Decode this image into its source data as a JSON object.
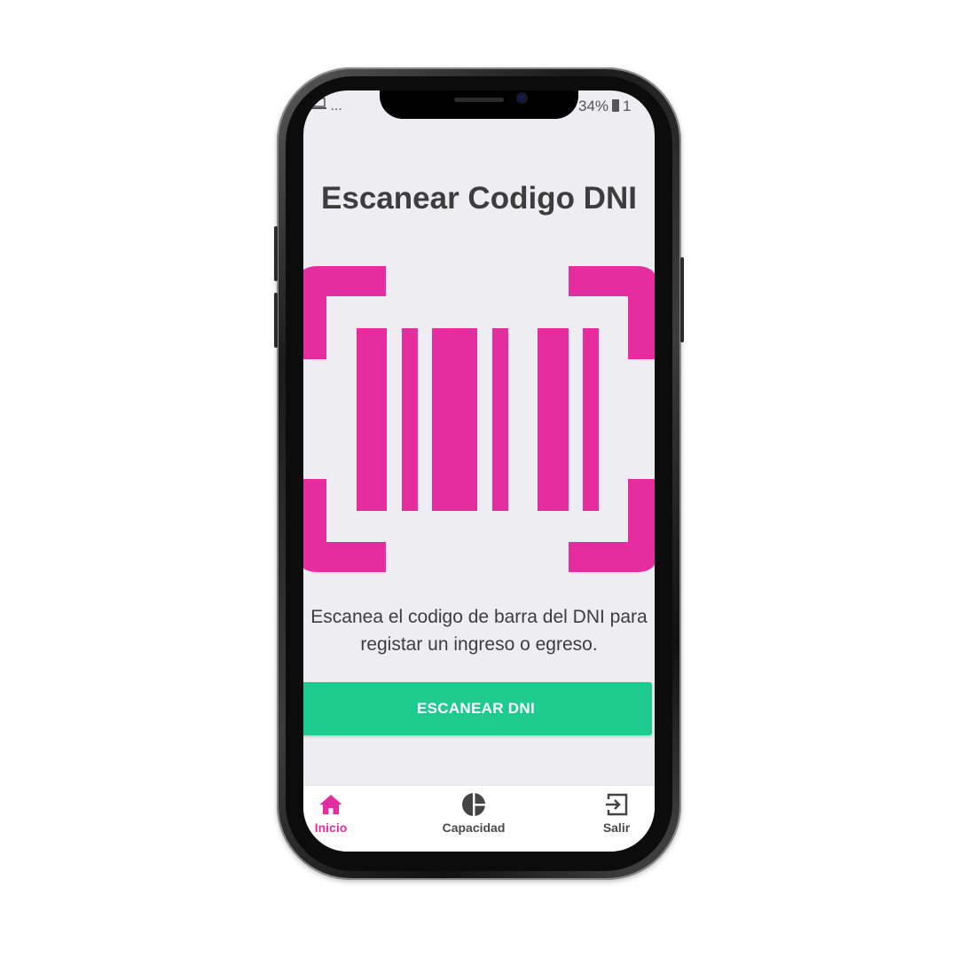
{
  "status_bar": {
    "left_text": "...",
    "battery": "34%",
    "time": "1"
  },
  "page": {
    "title": "Escanear Codigo DNI",
    "description_line1": "Escanea el codigo de barra del DNI para",
    "description_line2": "registar un ingreso o egreso.",
    "scan_button_label": "ESCANEAR DNI"
  },
  "tabs": [
    {
      "label": "Inicio",
      "icon": "home-icon",
      "active": true
    },
    {
      "label": "Capacidad",
      "icon": "pie-chart-icon",
      "active": false
    },
    {
      "label": "Salir",
      "icon": "exit-icon",
      "active": false
    }
  ],
  "colors": {
    "accent": "#e52d9f",
    "button": "#1ecb8f",
    "screen_background": "#ededf2",
    "text": "#3d3d3d"
  }
}
